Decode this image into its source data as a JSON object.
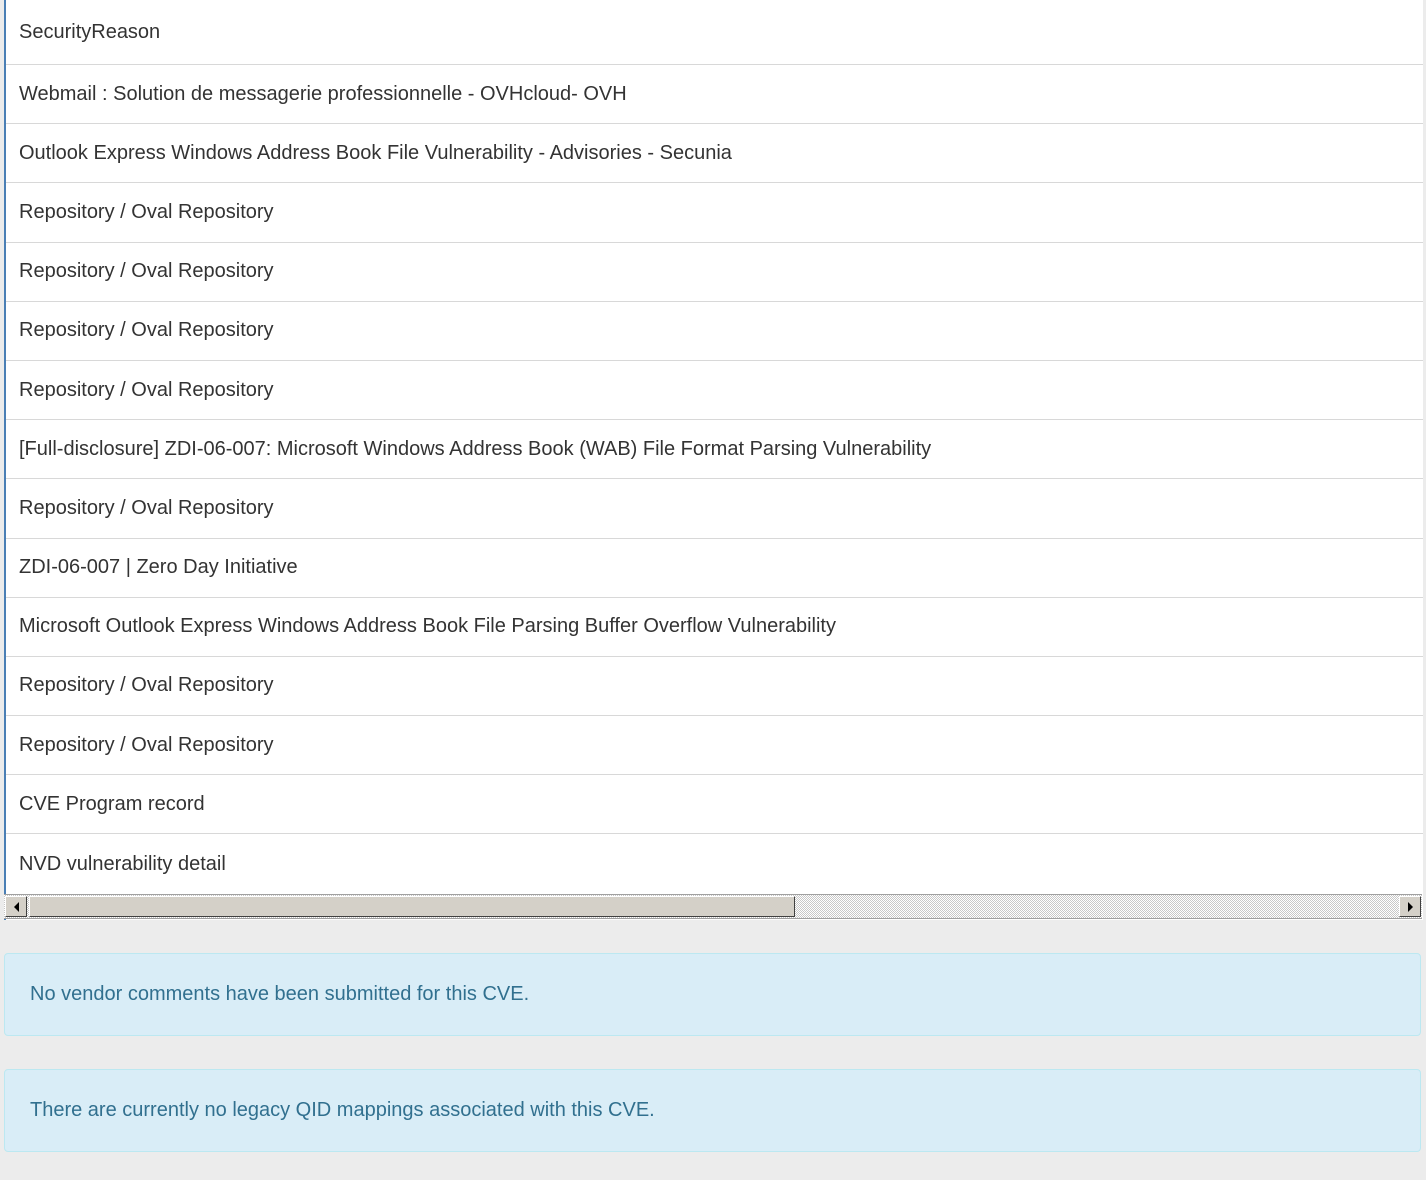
{
  "references": {
    "rows": [
      "SecurityReason",
      "Webmail : Solution de messagerie professionnelle - OVHcloud- OVH",
      "Outlook Express Windows Address Book File Vulnerability - Advisories - Secunia",
      "Repository / Oval Repository",
      "Repository / Oval Repository",
      "Repository / Oval Repository",
      "Repository / Oval Repository",
      "[Full-disclosure] ZDI-06-007: Microsoft Windows Address Book (WAB) File Format Parsing Vulnerability",
      "Repository / Oval Repository",
      "ZDI-06-007 | Zero Day Initiative",
      "Microsoft Outlook Express Windows Address Book File Parsing Buffer Overflow Vulnerability",
      "Repository / Oval Repository",
      "Repository / Oval Repository",
      "CVE Program record",
      "NVD vulnerability detail"
    ]
  },
  "scrollbar": {
    "left_arrow_icon": "arrow-left-icon",
    "right_arrow_icon": "arrow-right-icon",
    "scroll_position": 0,
    "visible_fraction": 0.56
  },
  "vendor_comments": {
    "message": "No vendor comments have been submitted for this CVE."
  },
  "qid_mappings": {
    "message": "There are currently no legacy QID mappings associated with this CVE."
  },
  "colors": {
    "alert_background": "#d9edf7",
    "alert_text": "#31708f",
    "accent_border": "#4a7fb5"
  }
}
